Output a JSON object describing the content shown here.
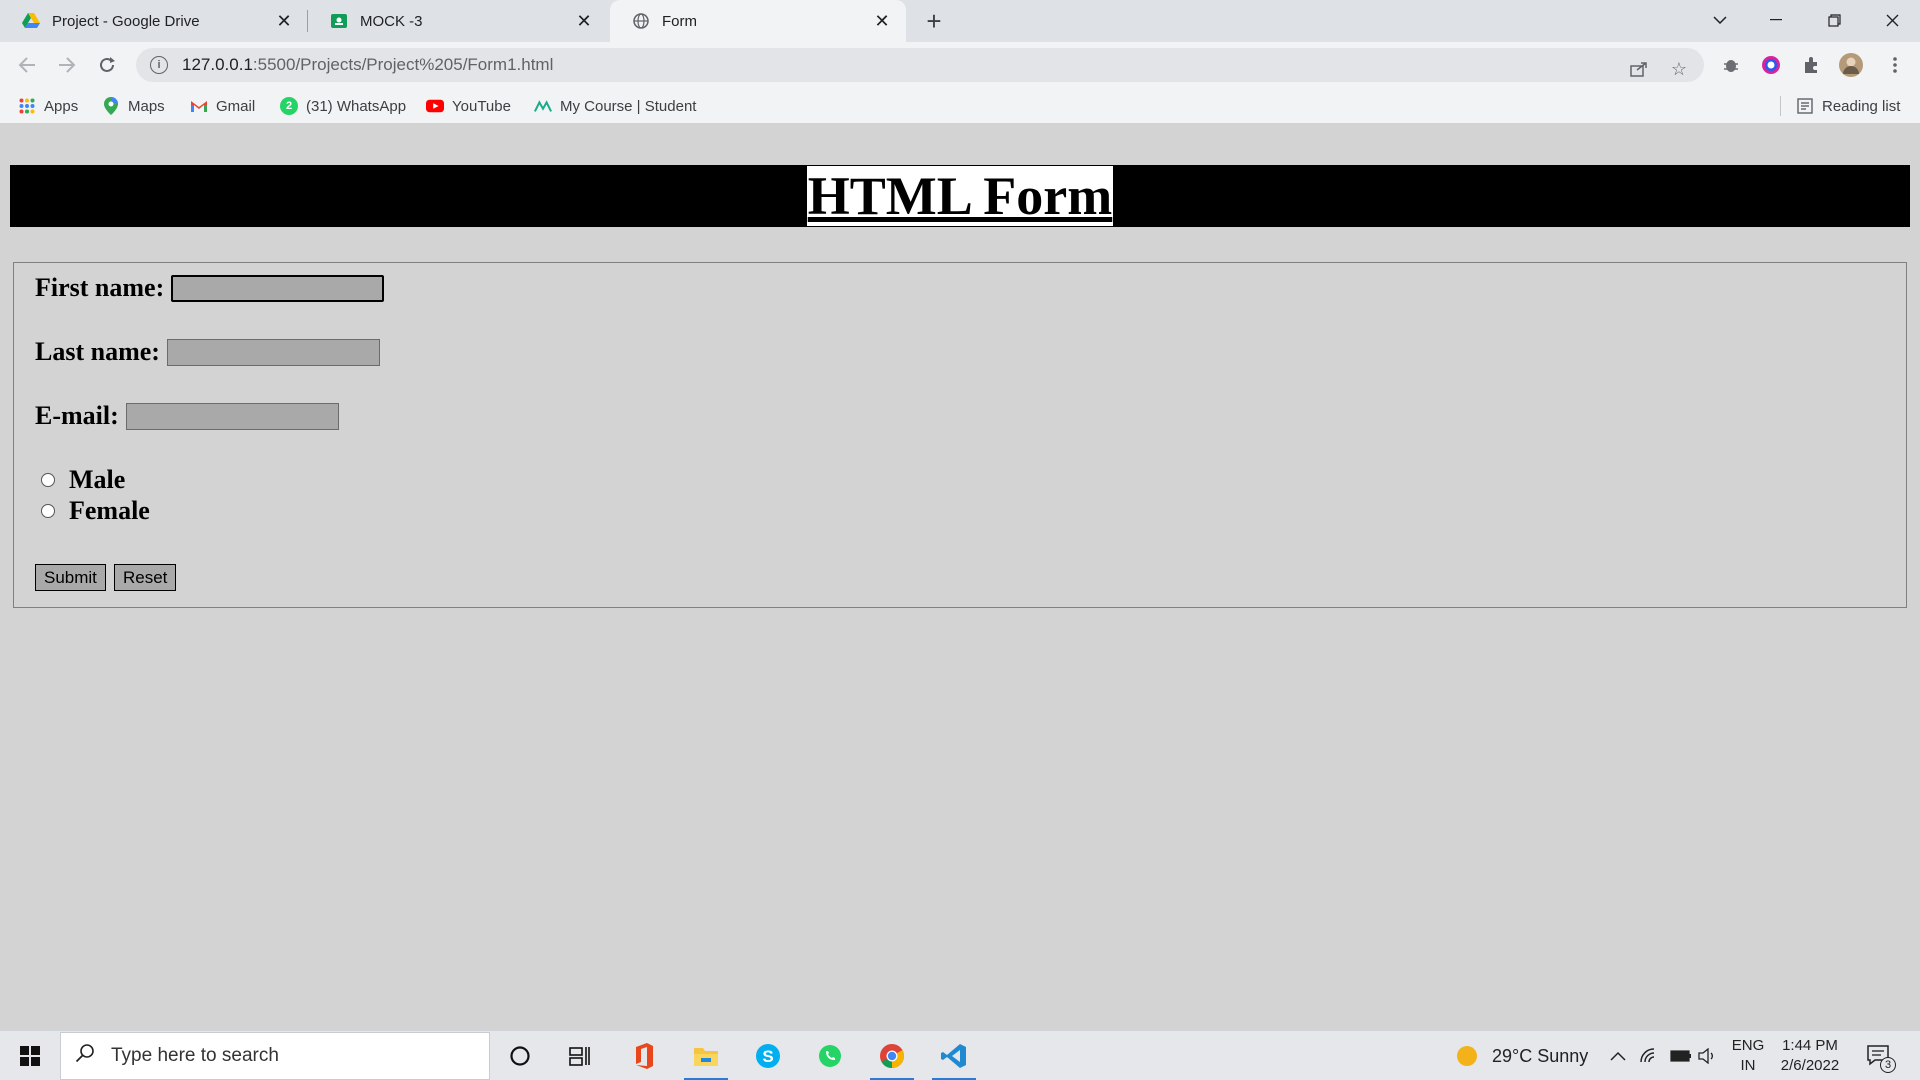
{
  "browser": {
    "tabs": [
      {
        "title": "Project - Google Drive",
        "icon": "google-drive-icon"
      },
      {
        "title": "MOCK -3",
        "icon": "google-classroom-icon"
      },
      {
        "title": "Form",
        "icon": "globe-icon",
        "active": true
      }
    ],
    "url_host": "127.0.0.1",
    "url_path": ":5500/Projects/Project%205/Form1.html",
    "bookmarks": [
      {
        "label": "Apps",
        "icon": "apps-grid-icon"
      },
      {
        "label": "Maps",
        "icon": "maps-pin-icon"
      },
      {
        "label": "Gmail",
        "icon": "gmail-icon"
      },
      {
        "label": "(31) WhatsApp",
        "icon": "whatsapp-icon"
      },
      {
        "label": "YouTube",
        "icon": "youtube-icon"
      },
      {
        "label": "My Course | Student",
        "icon": "course-icon"
      }
    ],
    "reading_list": "Reading list"
  },
  "page": {
    "heading": "HTML Form",
    "fields": {
      "first_name_label": "First name:",
      "last_name_label": "Last name:",
      "email_label": "E-mail:"
    },
    "gender": {
      "male": "Male",
      "female": "Female"
    },
    "buttons": {
      "submit": "Submit",
      "reset": "Reset"
    }
  },
  "taskbar": {
    "search_placeholder": "Type here to search",
    "weather": "29°C  Sunny",
    "lang_top": "ENG",
    "lang_bottom": "IN",
    "time": "1:44 PM",
    "date": "2/6/2022",
    "notifications": "3"
  },
  "colors": {
    "page_bg": "#d3d3d3",
    "header_bar": "#000000",
    "input_bg": "#a9a9a9"
  }
}
